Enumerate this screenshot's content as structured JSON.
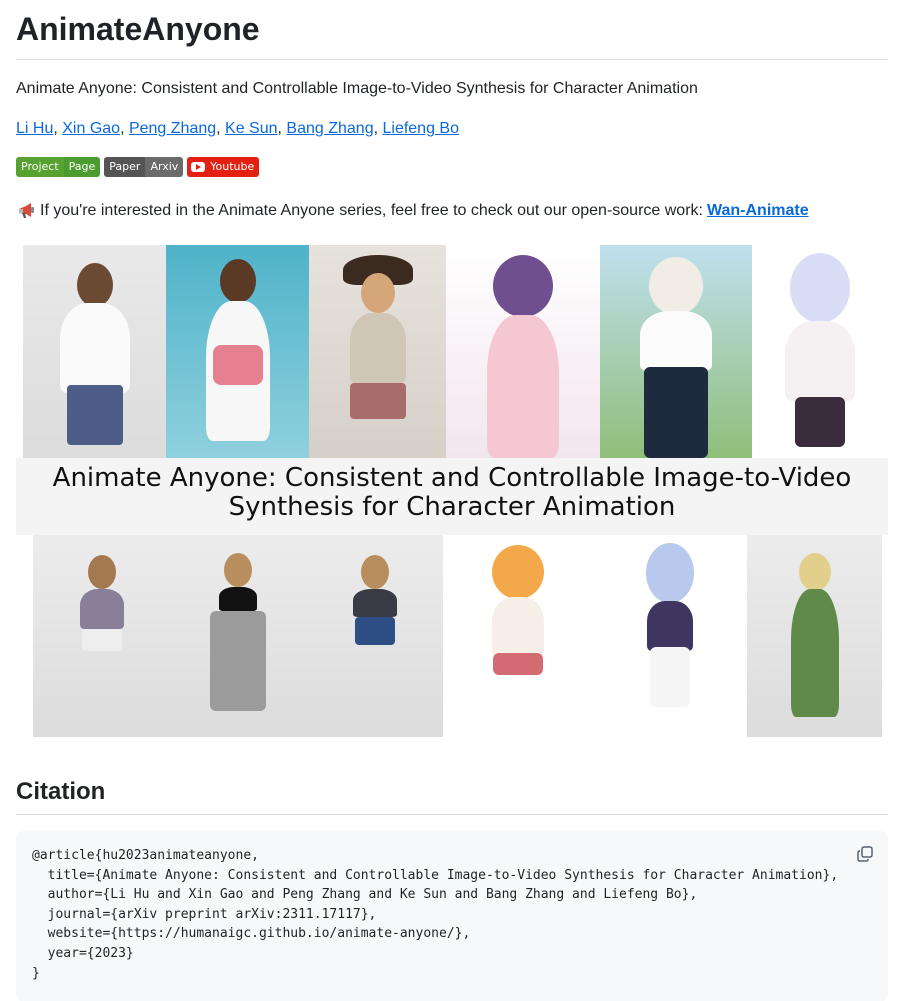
{
  "header": {
    "title": "AnimateAnyone"
  },
  "subtitle": "Animate Anyone: Consistent and Controllable Image-to-Video Synthesis for Character Animation",
  "authors": [
    {
      "name": "Li Hu"
    },
    {
      "name": "Xin Gao"
    },
    {
      "name": "Peng Zhang"
    },
    {
      "name": "Ke Sun"
    },
    {
      "name": "Bang Zhang"
    },
    {
      "name": "Liefeng Bo"
    }
  ],
  "badges": {
    "project": {
      "left": "Project",
      "right": "Page"
    },
    "paper": {
      "left": "Paper",
      "right": "Arxiv"
    },
    "youtube": {
      "label": "Youtube"
    }
  },
  "notice": {
    "icon": "megaphone-icon",
    "text": "If you're interested in the Animate Anyone series, feel free to check out our open-source work:",
    "link_text": "Wan-Animate"
  },
  "hero_image": {
    "title_line1": "Animate Anyone: Consistent and Controllable Image-to-Video",
    "title_line2": "Synthesis for Character Animation"
  },
  "citation": {
    "heading": "Citation",
    "code": "@article{hu2023animateanyone,\n  title={Animate Anyone: Consistent and Controllable Image-to-Video Synthesis for Character Animation},\n  author={Li Hu and Xin Gao and Peng Zhang and Ke Sun and Bang Zhang and Liefeng Bo},\n  journal={arXiv preprint arXiv:2311.17117},\n  website={https://humanaigc.github.io/animate-anyone/},\n  year={2023}\n}",
    "copy_icon": "copy-icon"
  },
  "colors": {
    "link": "#0969da",
    "badge_green": "#56a12f",
    "badge_gray": "#555555",
    "youtube_red": "#e32012",
    "code_bg": "#f6f8fa"
  }
}
